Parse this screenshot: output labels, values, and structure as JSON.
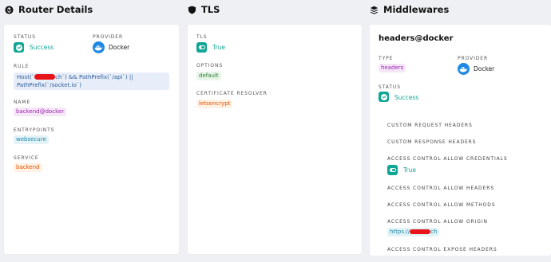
{
  "columns": {
    "router": {
      "title": "Router Details",
      "icon": "router-icon"
    },
    "tls": {
      "title": "TLS",
      "icon": "shield-icon"
    },
    "middlewares": {
      "title": "Middlewares",
      "icon": "layers-icon"
    }
  },
  "router": {
    "status_label": "STATUS",
    "status_value": "Success",
    "provider_label": "PROVIDER",
    "provider_value": "Docker",
    "rule_label": "RULE",
    "rule_part1": "Host(`",
    "rule_part2": "ch`) && PathPrefix(`/api`) ||",
    "rule_line2": "PathPrefix(`/socket.io`)",
    "name_label": "NAME",
    "name_value": "backend@docker",
    "entrypoints_label": "ENTRYPOINTS",
    "entrypoints_value": "websecure",
    "service_label": "SERVICE",
    "service_value": "backend"
  },
  "tls": {
    "tls_label": "TLS",
    "tls_value": "True",
    "options_label": "OPTIONS",
    "options_value": "default",
    "resolver_label": "CERTIFICATE RESOLVER",
    "resolver_value": "letsencrypt"
  },
  "middleware": {
    "title": "headers@docker",
    "type_label": "TYPE",
    "type_value": "headers",
    "provider_label": "PROVIDER",
    "provider_value": "Docker",
    "status_label": "STATUS",
    "status_value": "Success",
    "custom_request_headers": "CUSTOM REQUEST HEADERS",
    "custom_response_headers": "CUSTOM RESPONSE HEADERS",
    "allow_credentials_label": "ACCESS CONTROL ALLOW CREDENTIALS",
    "allow_credentials_value": "True",
    "allow_headers_label": "ACCESS CONTROL ALLOW HEADERS",
    "allow_methods_label": "ACCESS CONTROL ALLOW METHODS",
    "allow_origin_label": "ACCESS CONTROL ALLOW ORIGIN",
    "allow_origin_prefix": "https://",
    "allow_origin_suffix": "ch",
    "expose_headers_label": "ACCESS CONTROL EXPOSE HEADERS"
  },
  "colors": {
    "success": "#10a696",
    "docker": "#1d89e4",
    "redaction": "#e8141b"
  }
}
